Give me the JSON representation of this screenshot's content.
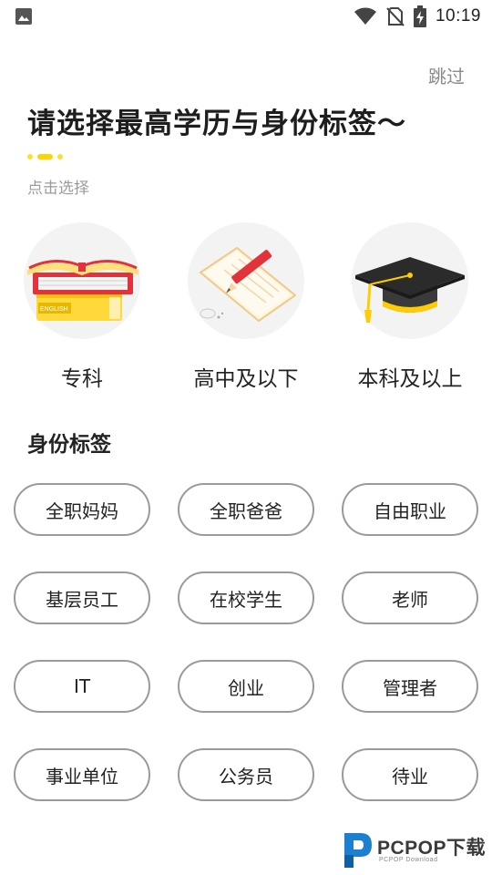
{
  "status_bar": {
    "time": "10:19",
    "icons": [
      "image-icon",
      "wifi-icon",
      "no-sim-icon",
      "battery-charging-icon"
    ]
  },
  "header": {
    "skip_label": "跳过",
    "title": "请选择最高学历与身份标签～",
    "hint": "点击选择"
  },
  "education": {
    "options": [
      {
        "label": "专科",
        "icon": "books-icon"
      },
      {
        "label": "高中及以下",
        "icon": "notebook-pencil-icon"
      },
      {
        "label": "本科及以上",
        "icon": "graduation-cap-icon"
      }
    ]
  },
  "identity": {
    "title": "身份标签",
    "tags": [
      "全职妈妈",
      "全职爸爸",
      "自由职业",
      "基层员工",
      "在校学生",
      "老师",
      "IT",
      "创业",
      "管理者",
      "事业单位",
      "公务员",
      "待业"
    ]
  },
  "watermark": {
    "brand": "PCPOP下载",
    "sub": "PCPOP Download"
  },
  "colors": {
    "accent": "#ffd400",
    "tag_border": "#9a9a9a",
    "circle_bg": "#f3f3f3"
  }
}
